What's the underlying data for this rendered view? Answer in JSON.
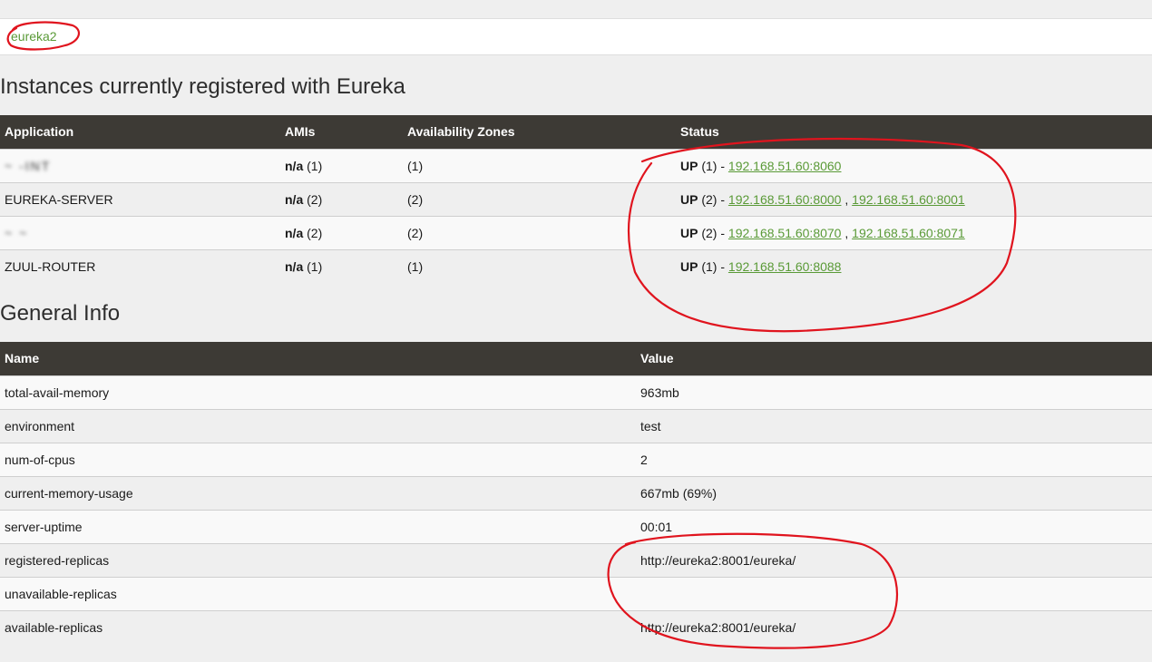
{
  "replicas_bar": {
    "link": "eureka2"
  },
  "instances": {
    "title": "Instances currently registered with Eureka",
    "columns": [
      "Application",
      "AMIs",
      "Availability Zones",
      "Status"
    ],
    "rows": [
      {
        "app": "~ -INT",
        "amis": "n/a",
        "amis_count": "(1)",
        "zones": "(1)",
        "status": "UP",
        "status_count": "(1) -",
        "links": [
          "192.168.51.60:8060"
        ]
      },
      {
        "app": "EUREKA-SERVER",
        "amis": "n/a",
        "amis_count": "(2)",
        "zones": "(2)",
        "status": "UP",
        "status_count": "(2) -",
        "links": [
          "192.168.51.60:8000",
          "192.168.51.60:8001"
        ]
      },
      {
        "app": "~ ~",
        "amis": "n/a",
        "amis_count": "(2)",
        "zones": "(2)",
        "status": "UP",
        "status_count": "(2) -",
        "links": [
          "192.168.51.60:8070",
          "192.168.51.60:8071"
        ]
      },
      {
        "app": "ZUUL-ROUTER",
        "amis": "n/a",
        "amis_count": "(1)",
        "zones": "(1)",
        "status": "UP",
        "status_count": "(1) -",
        "links": [
          "192.168.51.60:8088"
        ]
      }
    ]
  },
  "general": {
    "title": "General Info",
    "columns": [
      "Name",
      "Value"
    ],
    "rows": [
      {
        "name": "total-avail-memory",
        "value": "963mb"
      },
      {
        "name": "environment",
        "value": "test"
      },
      {
        "name": "num-of-cpus",
        "value": "2"
      },
      {
        "name": "current-memory-usage",
        "value": "667mb (69%)"
      },
      {
        "name": "server-uptime",
        "value": "00:01"
      },
      {
        "name": "registered-replicas",
        "value": "http://eureka2:8001/eureka/"
      },
      {
        "name": "unavailable-replicas",
        "value": ""
      },
      {
        "name": "available-replicas",
        "value": "http://eureka2:8001/eureka/"
      }
    ]
  },
  "colors": {
    "header_bg": "#3d3a35",
    "link_green": "#5a9a37",
    "annotation_red": "#e0141e"
  }
}
